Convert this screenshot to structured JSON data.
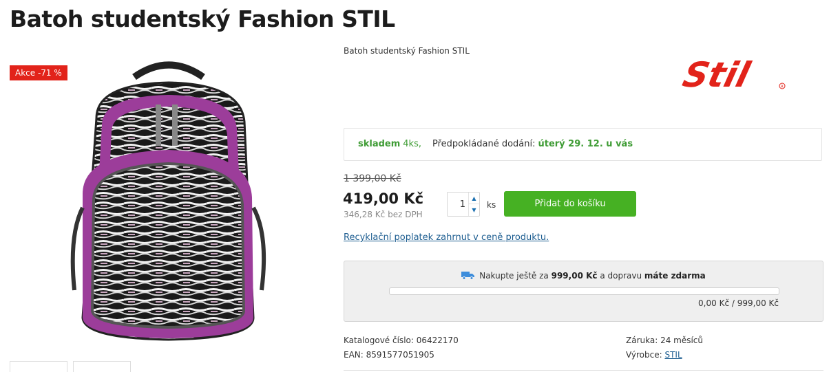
{
  "product": {
    "title": "Batoh studentský Fashion STIL",
    "short_description": "Batoh studentský Fashion STIL",
    "badge": "Akce -71 %",
    "brand_logo_text": "Stil"
  },
  "availability": {
    "stock_label": "skladem",
    "stock_qty": "4ks,",
    "delivery_label": "Předpokládané dodání:",
    "delivery_date": "úterý 29. 12. u vás"
  },
  "pricing": {
    "old_price": "1 399,00 Kč",
    "price": "419,00 Kč",
    "price_without_vat": "346,28 Kč bez DPH"
  },
  "cart": {
    "quantity": "1",
    "unit": "ks",
    "add_button_label": "Přidat do košíku"
  },
  "recycling_note": "Recyklační poplatek zahrnut v ceně produktu.",
  "free_shipping": {
    "text_before": "Nakupte ještě za",
    "remaining": "999,00 Kč",
    "text_middle": "a dopravu",
    "text_bold": "máte zdarma",
    "progress_text": "0,00 Kč / 999,00 Kč",
    "progress_fraction": 0
  },
  "parameters": {
    "catalog_number": "Katalogové číslo: 06422170",
    "ean": "EAN: 8591577051905",
    "warranty": "Záruka: 24 měsíců",
    "manufacturer_label": "Výrobce:",
    "manufacturer_link": "STIL"
  },
  "colors": {
    "accent_green": "#46b123",
    "sale_red": "#e2231a",
    "link_blue": "#1d5d90"
  }
}
